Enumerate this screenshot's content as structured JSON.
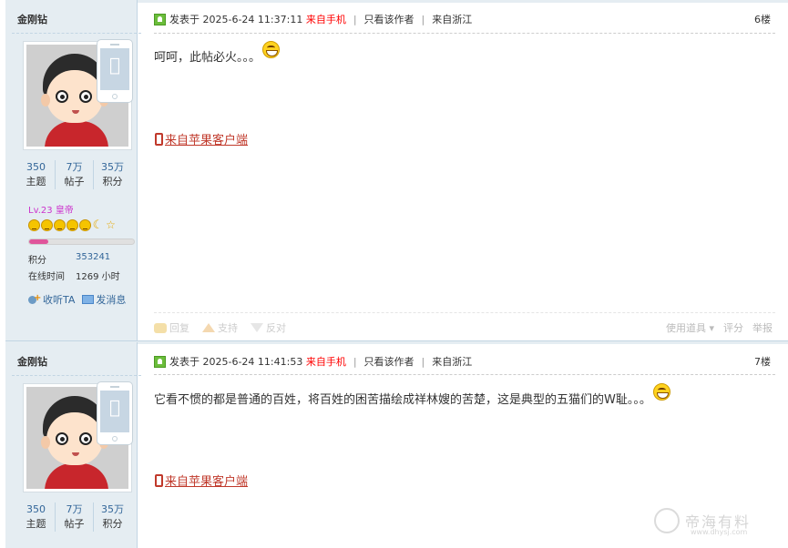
{
  "posts": [
    {
      "user": {
        "name": "金刚钻",
        "stats": [
          {
            "num": "350",
            "label": "主题"
          },
          {
            "num": "7万",
            "label": "帖子"
          },
          {
            "num": "35万",
            "label": "积分"
          }
        ],
        "level": "Lv.23",
        "rank": "皇帝",
        "level_progress": 0.18,
        "points_label": "积分",
        "points_value": "353241",
        "online_label": "在线时间",
        "online_value": "1269 小时",
        "follow_label": "收听TA",
        "message_label": "发消息"
      },
      "meta": {
        "posted_prefix": "发表于",
        "datetime": "2025-6-24 11:37:11",
        "via": "来自手机",
        "only_author": "只看该作者",
        "region": "来自浙江"
      },
      "floor": "6楼",
      "text": "呵呵，此帖必火。。。",
      "client": "来自苹果客户端",
      "footer": {
        "reply": "回复",
        "support": "支持",
        "oppose": "反对",
        "tools": "使用道具",
        "rate": "评分",
        "report": "举报"
      }
    },
    {
      "user": {
        "name": "金刚钻",
        "stats": [
          {
            "num": "350",
            "label": "主题"
          },
          {
            "num": "7万",
            "label": "帖子"
          },
          {
            "num": "35万",
            "label": "积分"
          }
        ]
      },
      "meta": {
        "posted_prefix": "发表于",
        "datetime": "2025-6-24 11:41:53",
        "via": "来自手机",
        "only_author": "只看该作者",
        "region": "来自浙江"
      },
      "floor": "7楼",
      "text": "它看不惯的都是普通的百姓，将百姓的困苦描绘成祥林嫂的苦楚，这是典型的五猫们的W耻。。。",
      "client": "来自苹果客户端"
    }
  ],
  "watermark": {
    "text": "帝海有料",
    "url": "www.dhysj.com"
  },
  "colors": {
    "sidebar_bg": "#e5edf2",
    "link_blue": "#336699",
    "accent_red": "#ff0000",
    "client_red": "#c0392b",
    "level_pink": "#cc33cc"
  }
}
